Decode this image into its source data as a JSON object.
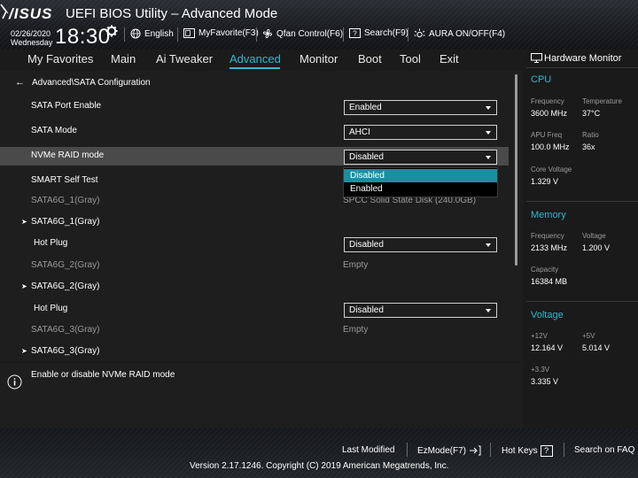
{
  "header": {
    "logo": "/ISUS",
    "title": "UEFI BIOS Utility – Advanced Mode",
    "date": "02/26/2020",
    "weekday": "Wednesday",
    "time": "18:30",
    "toolbar": {
      "language": "English",
      "favorite": "MyFavorite(F3)",
      "qfan": "Qfan Control(F6)",
      "search": "Search(F9)",
      "aura": "AURA ON/OFF(F4)"
    }
  },
  "menu": {
    "items": [
      "My Favorites",
      "Main",
      "Ai Tweaker",
      "Advanced",
      "Monitor",
      "Boot",
      "Tool",
      "Exit"
    ],
    "active": "Advanced"
  },
  "main": {
    "breadcrumb": "Advanced\\SATA Configuration",
    "rows": {
      "sata_port_enable": {
        "label": "SATA Port Enable",
        "value": "Enabled"
      },
      "sata_mode": {
        "label": "SATA Mode",
        "value": "AHCI"
      },
      "nvme_raid": {
        "label": "NVMe RAID mode",
        "value": "Disabled"
      },
      "smart_self_test": {
        "label": "SMART Self Test"
      },
      "sata6g_1_info": {
        "label": "SATA6G_1(Gray)",
        "value": "SPCC Solid State Disk (240.0GB)"
      },
      "sata6g_1": {
        "label": "SATA6G_1(Gray)"
      },
      "hot_plug_1": {
        "label": "Hot Plug",
        "value": "Disabled"
      },
      "sata6g_2_info": {
        "label": "SATA6G_2(Gray)",
        "value": "Empty"
      },
      "sata6g_2": {
        "label": "SATA6G_2(Gray)"
      },
      "hot_plug_2": {
        "label": "Hot Plug",
        "value": "Disabled"
      },
      "sata6g_3_info": {
        "label": "SATA6G_3(Gray)",
        "value": "Empty"
      },
      "sata6g_3": {
        "label": "SATA6G_3(Gray)"
      }
    },
    "dropdown": {
      "options": [
        "Disabled",
        "Enabled"
      ],
      "selected": "Disabled"
    }
  },
  "help": {
    "text": "Enable or disable NVMe RAID mode"
  },
  "hardware_monitor": {
    "title": "Hardware Monitor",
    "cpu": {
      "section": "CPU",
      "frequency_label": "Frequency",
      "frequency": "3600 MHz",
      "temperature_label": "Temperature",
      "temperature": "37°C",
      "apu_freq_label": "APU Freq",
      "apu_freq": "100.0 MHz",
      "ratio_label": "Ratio",
      "ratio": "36x",
      "core_voltage_label": "Core Voltage",
      "core_voltage": "1.329 V"
    },
    "memory": {
      "section": "Memory",
      "frequency_label": "Frequency",
      "frequency": "2133 MHz",
      "voltage_label": "Voltage",
      "voltage": "1.200 V",
      "capacity_label": "Capacity",
      "capacity": "16384 MB"
    },
    "voltage": {
      "section": "Voltage",
      "v12_label": "+12V",
      "v12": "12.164 V",
      "v5_label": "+5V",
      "v5": "5.014 V",
      "v33_label": "+3.3V",
      "v33": "3.335 V"
    }
  },
  "footer": {
    "last_modified": "Last Modified",
    "ezmode": "EzMode(F7)",
    "hot_keys": "Hot Keys",
    "hot_keys_key": "?",
    "search_faq": "Search on FAQ",
    "copyright": "Version 2.17.1246. Copyright (C) 2019 American Megatrends, Inc."
  },
  "colors": {
    "accent": "#2fb8d0",
    "selection": "#1b8fa0",
    "highlight_row": "#4a4a4a"
  }
}
